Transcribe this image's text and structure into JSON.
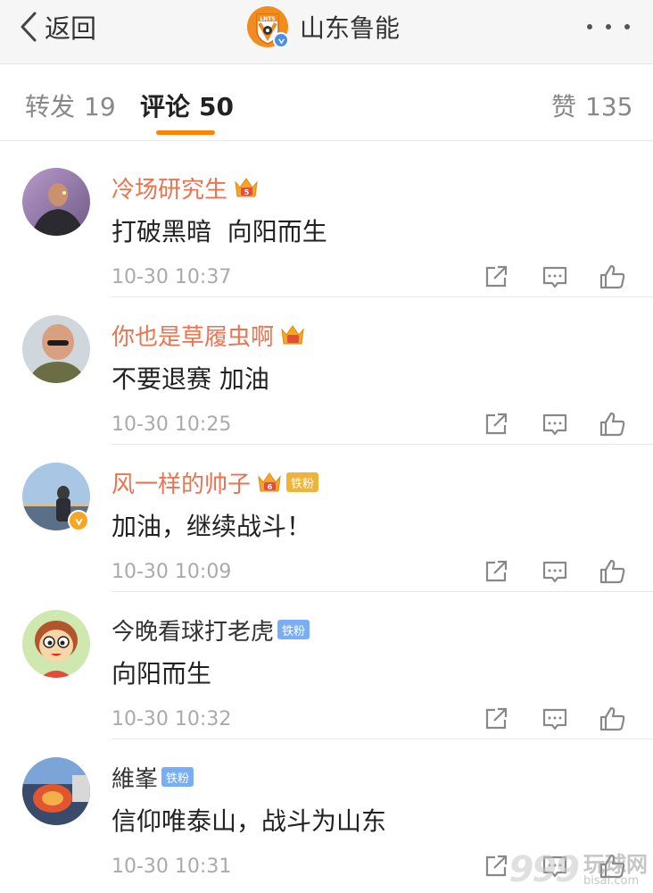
{
  "nav": {
    "back_label": "返回",
    "title": "山东鲁能",
    "logo_text": "LNTS"
  },
  "tabs": [
    {
      "label": "转发",
      "count": "19",
      "active": false
    },
    {
      "label": "评论",
      "count": "50",
      "active": true
    },
    {
      "label": "赞",
      "count": "135",
      "active": false
    }
  ],
  "colors": {
    "accent": "#ff8200",
    "vip_name": "#eb7350",
    "crown": "#f5a623",
    "fan_blue": "#79aef5"
  },
  "comments": [
    {
      "username": "冷场研究生",
      "vip": true,
      "crown_level": "5",
      "fan_tag": "",
      "content": "打破黑暗  向阳而生",
      "time": "10-30 10:37"
    },
    {
      "username": "你也是草履虫啊",
      "vip": true,
      "crown_level": "",
      "fan_tag": "",
      "content": "不要退赛 加油",
      "time": "10-30 10:25"
    },
    {
      "username": "风一样的帅子",
      "vip": true,
      "crown_level": "6",
      "fan_tag": "铁粉",
      "content": "加油，继续战斗！",
      "time": "10-30 10:09",
      "verified": true
    },
    {
      "username": "今晚看球打老虎",
      "vip": false,
      "crown_level": "",
      "fan_tag": "铁粉",
      "content": "向阳而生",
      "time": "10-30 10:32"
    },
    {
      "username": "維峯",
      "vip": false,
      "crown_level": "",
      "fan_tag": "铁粉",
      "content": "信仰唯泰山，战斗为山东",
      "time": "10-30 10:31"
    }
  ],
  "icons": {
    "back": "chevron-left-icon",
    "more": "more-dots-icon",
    "share": "share-icon",
    "reply": "comment-icon",
    "like": "thumbs-up-icon"
  },
  "watermark": {
    "number": "999",
    "cn": "玩球网",
    "url": "bisai.com"
  }
}
